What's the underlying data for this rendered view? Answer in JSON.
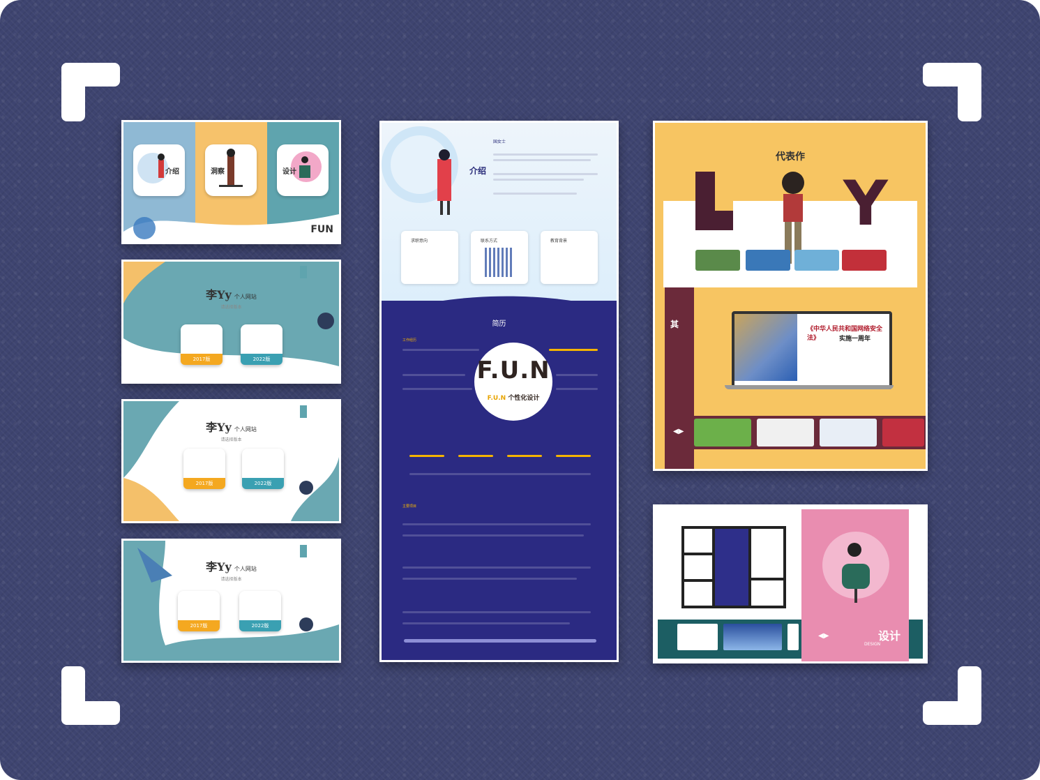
{
  "card1": {
    "tiles": [
      "介绍",
      "洞察",
      "设计"
    ],
    "logo": "FUN"
  },
  "site_versions": [
    {
      "brand": "李Yy",
      "tagline": "个人网站",
      "subtitle": "请选择版本",
      "v1": "2017版",
      "v2": "2022版"
    },
    {
      "brand": "李Yy",
      "tagline": "个人网站",
      "subtitle": "请选择版本",
      "v1": "2017版",
      "v2": "2022版"
    },
    {
      "brand": "李Yy",
      "tagline": "个人网站",
      "subtitle": "请选择版本",
      "v1": "2017版",
      "v2": "2022版"
    }
  ],
  "resume": {
    "intro_title": "介绍",
    "name": "国女士",
    "boxes": [
      "求职意向",
      "联系方式",
      "教育背景"
    ],
    "section": "简历",
    "work_label": "工作经历",
    "projects_label": "主要项目",
    "logo": "F.U.N",
    "logo_sub_a": "F.U.N",
    "logo_sub_b": "个性化设计"
  },
  "portfolio": {
    "title": "代表作",
    "letters": [
      "L",
      "Y"
    ],
    "side_label": "其",
    "laptop_title": "《中华人民共和国网络安全法》",
    "laptop_sub": "实施一周年",
    "arrows": "◀▶"
  },
  "design": {
    "label": "设计",
    "sub": "DESIGN",
    "arrows": "◀▶"
  }
}
